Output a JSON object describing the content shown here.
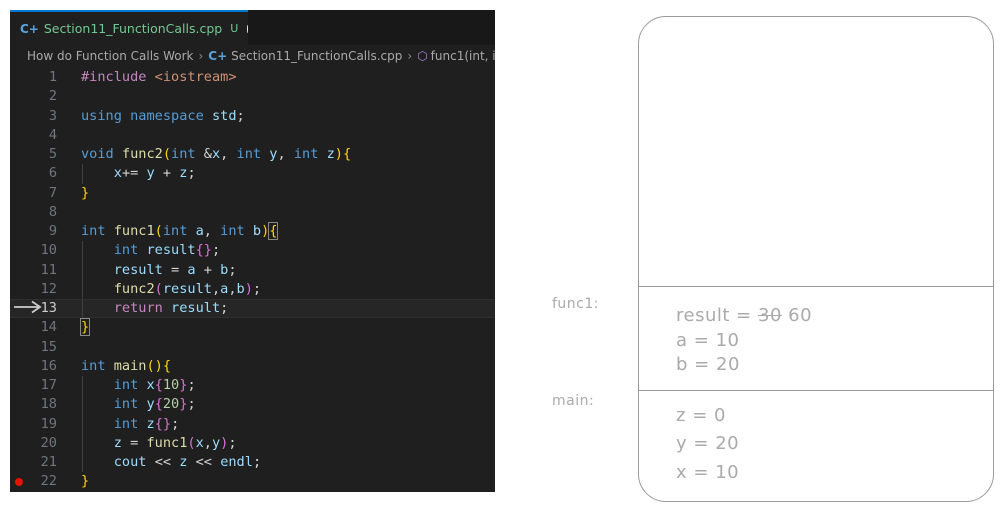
{
  "tab": {
    "icon": "C+",
    "filename": "Section11_FunctionCalls.cpp",
    "status": "U"
  },
  "breadcrumb": {
    "folder": "How do Function Calls Work",
    "file_icon": "C+",
    "file": "Section11_FunctionCalls.cpp",
    "symbol_icon": "cube-icon",
    "symbol": "func1(int, i"
  },
  "editor": {
    "current_line": 13,
    "breakpoint_line": 22,
    "lines": [
      "1",
      "2",
      "3",
      "4",
      "5",
      "6",
      "7",
      "8",
      "9",
      "10",
      "11",
      "12",
      "13",
      "14",
      "15",
      "16",
      "17",
      "18",
      "19",
      "20",
      "21",
      "22"
    ]
  },
  "stack": {
    "frames": [
      {
        "label": "func1:",
        "vars": [
          {
            "name": "result",
            "old_value": "30",
            "value": "60"
          },
          {
            "name": "a",
            "value": "10"
          },
          {
            "name": "b",
            "value": "20"
          }
        ]
      },
      {
        "label": "main:",
        "vars": [
          {
            "name": "z",
            "value": "0"
          },
          {
            "name": "y",
            "value": "20"
          },
          {
            "name": "x",
            "value": "10"
          }
        ]
      }
    ]
  },
  "colors": {
    "editor_bg": "#1f1f1f",
    "keyword": "#569cd6",
    "preprocessor": "#c586c0",
    "function": "#dcdcaa",
    "variable": "#9cdcfe",
    "string": "#ce9178",
    "number": "#b5cea8",
    "breakpoint": "#e51400",
    "sketch": "#aaaaaa"
  }
}
